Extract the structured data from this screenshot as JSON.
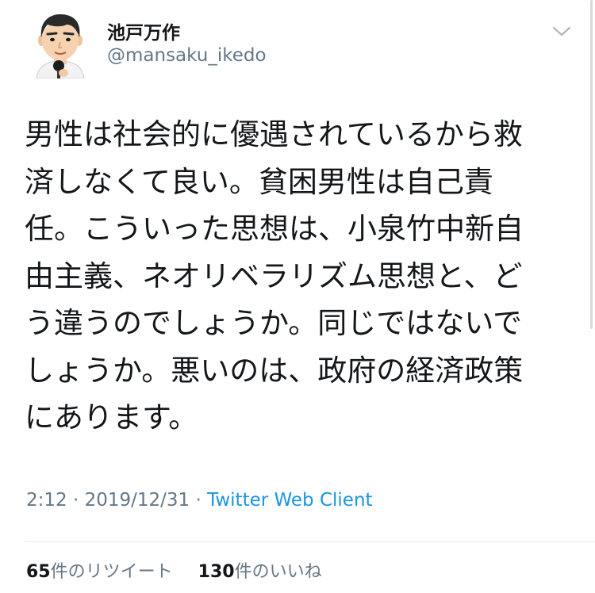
{
  "author": {
    "display_name": "池戸万作",
    "handle": "@mansaku_ikedo",
    "avatar_icon": "cartoon-man-with-microphone-avatar"
  },
  "menu": {
    "icon": "chevron-down-icon"
  },
  "tweet": {
    "lines": [
      "男性は社会的に優遇されているから救",
      "済しなくて良い。貧困男性は自己責",
      "任。こういった思想は、小泉竹中新自",
      "由主義、ネオリベラリズム思想と、ど",
      "う違うのでしょうか。同じではないで",
      "しょうか。悪いのは、政府の経済政策",
      "にあります。"
    ]
  },
  "meta": {
    "time": "2:12",
    "separator1": " · ",
    "date": "2019/12/31",
    "separator2": " · ",
    "source": "Twitter Web Client"
  },
  "stats": {
    "retweets_count": "65",
    "retweets_label": "件のリツイート",
    "likes_count": "130",
    "likes_label": "件のいいね"
  },
  "colors": {
    "text": "#14171a",
    "secondary": "#657786",
    "link": "#1b95e0",
    "divider": "#e6ecf0"
  }
}
